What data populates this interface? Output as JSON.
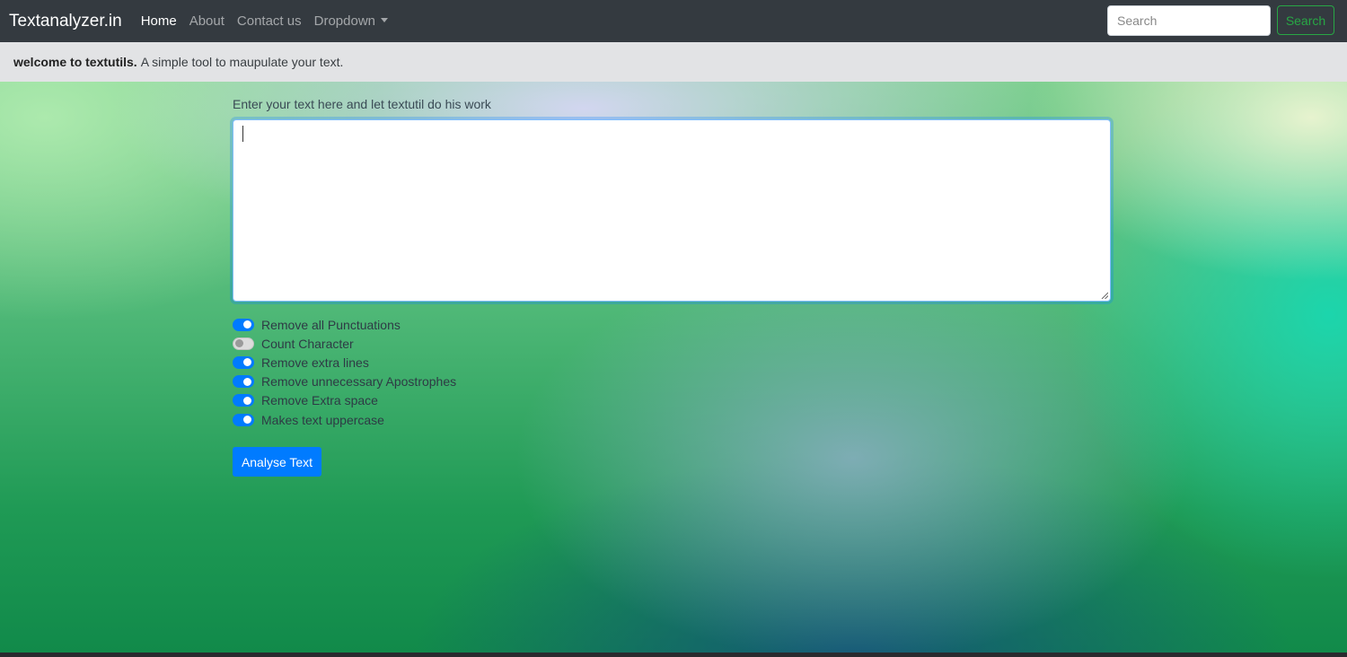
{
  "navbar": {
    "brand": "Textanalyzer.in",
    "links": [
      "Home",
      "About",
      "Contact us",
      "Dropdown"
    ],
    "search_placeholder": "Search",
    "search_button": "Search"
  },
  "alert": {
    "strong_text": "welcome to textutils.",
    "text": "A simple tool to maupulate your text."
  },
  "form": {
    "label": "Enter your text here and let textutil do his work",
    "textarea_value": "",
    "switches": [
      {
        "label": "Remove all Punctuations",
        "checked": true
      },
      {
        "label": "Count Character",
        "checked": false
      },
      {
        "label": "Remove extra lines",
        "checked": true
      },
      {
        "label": "Remove unnecessary Apostrophes",
        "checked": true
      },
      {
        "label": "Remove Extra space",
        "checked": true
      },
      {
        "label": "Makes text uppercase",
        "checked": true
      }
    ],
    "submit_label": "Analyse Text"
  },
  "colors": {
    "navbar": "#343a40",
    "alert": "#e2e3e5",
    "primary": "#007bff",
    "success": "#28a745"
  }
}
